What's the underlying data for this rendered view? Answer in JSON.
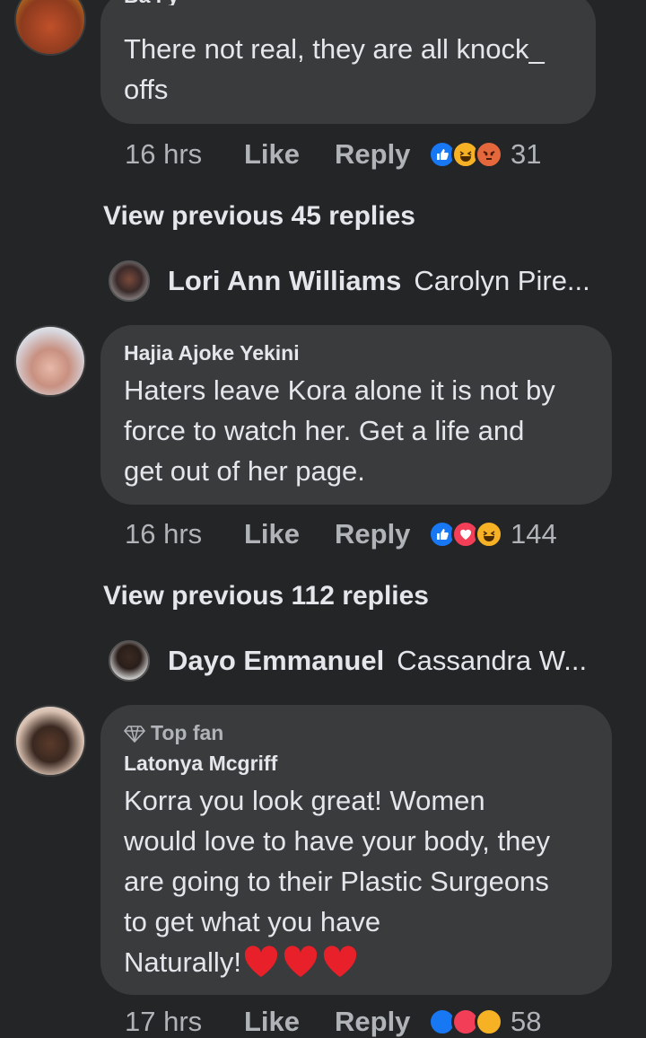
{
  "comments": [
    {
      "text": "There not real, they are all knock_\noffs",
      "time": "16 hrs",
      "like": "Like",
      "reply": "Reply",
      "reaction_count": "31",
      "reactions": [
        "like",
        "haha",
        "angry"
      ]
    },
    {
      "author": "Hajia Ajoke Yekini",
      "text_lines": [
        "Haters leave Kora alone it is not by",
        "force to watch her. Get a life and",
        "get out of her page."
      ],
      "time": "16 hrs",
      "like": "Like",
      "reply": "Reply",
      "reaction_count": "144",
      "reactions": [
        "like",
        "love",
        "haha"
      ]
    },
    {
      "badge": "Top fan",
      "author": "Latonya Mcgriff",
      "text_lines": [
        "Korra you look great!  Women",
        "would love to have your body, they",
        "are going to their Plastic Surgeons",
        "to get what you have",
        "Naturally!"
      ],
      "hearts": "❤️❤️❤️",
      "time": "17 hrs",
      "like": "Like",
      "reply": "Reply",
      "reaction_count": "58",
      "reactions": [
        "like",
        "love",
        "haha"
      ]
    }
  ],
  "view_previous": [
    {
      "label": "View previous 45 replies",
      "reply_name": "Lori Ann Williams",
      "reply_text": "Carolyn Pire..."
    },
    {
      "label": "View previous 112 replies",
      "reply_name": "Dayo Emmanuel",
      "reply_text": "Cassandra W..."
    }
  ],
  "colors": {
    "background": "#242526",
    "bubble": "#3a3b3c",
    "text": "#e4e6eb",
    "muted": "#b0b3b8",
    "like_blue": "#1877f2",
    "love_red": "#f33e58",
    "haha_yellow": "#f7b125",
    "angry_orange": "#e4683c"
  }
}
